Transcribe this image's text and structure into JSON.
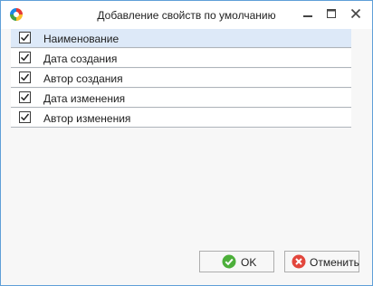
{
  "window": {
    "title": "Добавление свойств по умолчанию",
    "accent_color": "#5f9fd8"
  },
  "properties": {
    "items": [
      {
        "label": "Наименование",
        "checked": true,
        "selected": true
      },
      {
        "label": "Дата создания",
        "checked": true,
        "selected": false
      },
      {
        "label": "Автор создания",
        "checked": true,
        "selected": false
      },
      {
        "label": "Дата изменения",
        "checked": true,
        "selected": false
      },
      {
        "label": "Автор изменения",
        "checked": true,
        "selected": false
      }
    ]
  },
  "buttons": {
    "ok_label": "OK",
    "ok_icon": "check-circle-icon",
    "cancel_label": "Отменить",
    "cancel_icon": "x-circle-icon"
  },
  "colors": {
    "selected_row": "#dde9f8",
    "ok_icon": "#4caf3a",
    "cancel_icon": "#e2463c"
  }
}
